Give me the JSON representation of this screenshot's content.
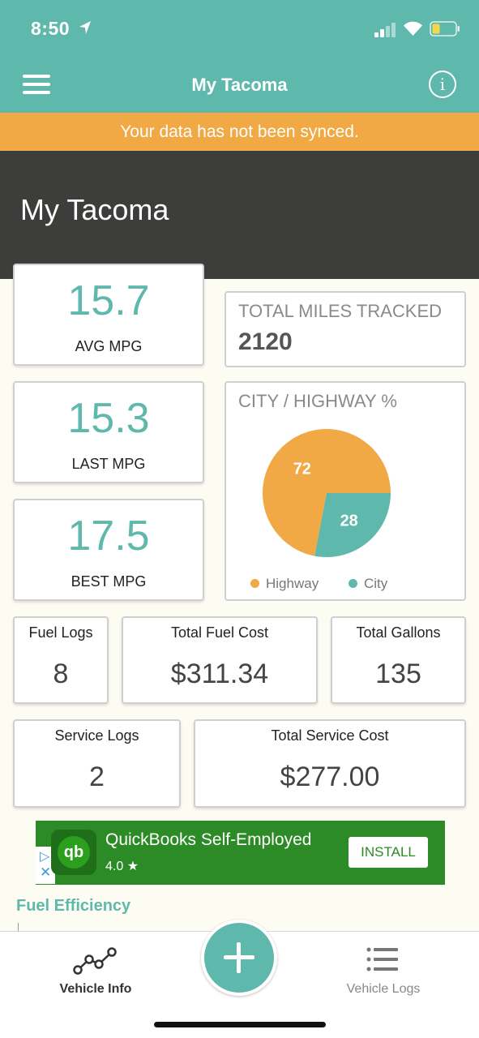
{
  "status_bar": {
    "time": "8:50"
  },
  "nav": {
    "title": "My Tacoma",
    "info_glyph": "i"
  },
  "banner": {
    "text": "Your data has not been synced."
  },
  "hero": {
    "title": "My Tacoma"
  },
  "mpg": {
    "avg": {
      "value": "15.7",
      "label": "AVG MPG"
    },
    "last": {
      "value": "15.3",
      "label": "LAST MPG"
    },
    "best": {
      "value": "17.5",
      "label": "BEST MPG"
    }
  },
  "total_miles": {
    "label": "TOTAL MILES TRACKED",
    "value": "2120"
  },
  "city_highway": {
    "label": "CITY / HIGHWAY %",
    "legend": {
      "highway": "Highway",
      "city": "City"
    },
    "highway_color": "#f0a944",
    "city_color": "#5fb8ac"
  },
  "chart_data": {
    "type": "pie",
    "categories": [
      "Highway",
      "City"
    ],
    "values": [
      72,
      28
    ],
    "title": "CITY / HIGHWAY %",
    "legend_position": "bottom"
  },
  "stats": {
    "fuel_logs": {
      "label": "Fuel Logs",
      "value": "8"
    },
    "total_fuel_cost": {
      "label": "Total Fuel Cost",
      "value": "$311.34"
    },
    "total_gallons": {
      "label": "Total Gallons",
      "value": "135"
    },
    "service_logs": {
      "label": "Service Logs",
      "value": "2"
    },
    "total_service_cost": {
      "label": "Total Service Cost",
      "value": "$277.00"
    }
  },
  "ad": {
    "title": "QuickBooks Self-Employed",
    "rating": "4.0 ★",
    "install_label": "INSTALL",
    "logo_text": "qb",
    "choice_glyph": "▷",
    "close_glyph": "✕"
  },
  "fuel_efficiency": {
    "title": "Fuel Efficiency"
  },
  "tabs": {
    "vehicle_info": "Vehicle Info",
    "vehicle_logs": "Vehicle Logs"
  },
  "colors": {
    "teal": "#5fb8ac",
    "orange": "#f0a944",
    "dark": "#3d3d3b",
    "ad_green": "#2c8b26"
  },
  "icons": [
    "location-arrow-icon",
    "signal-icon",
    "wifi-icon",
    "battery-icon",
    "menu-icon",
    "info-icon",
    "qb-logo-icon",
    "line-chart-icon",
    "plus-icon",
    "list-icon"
  ]
}
